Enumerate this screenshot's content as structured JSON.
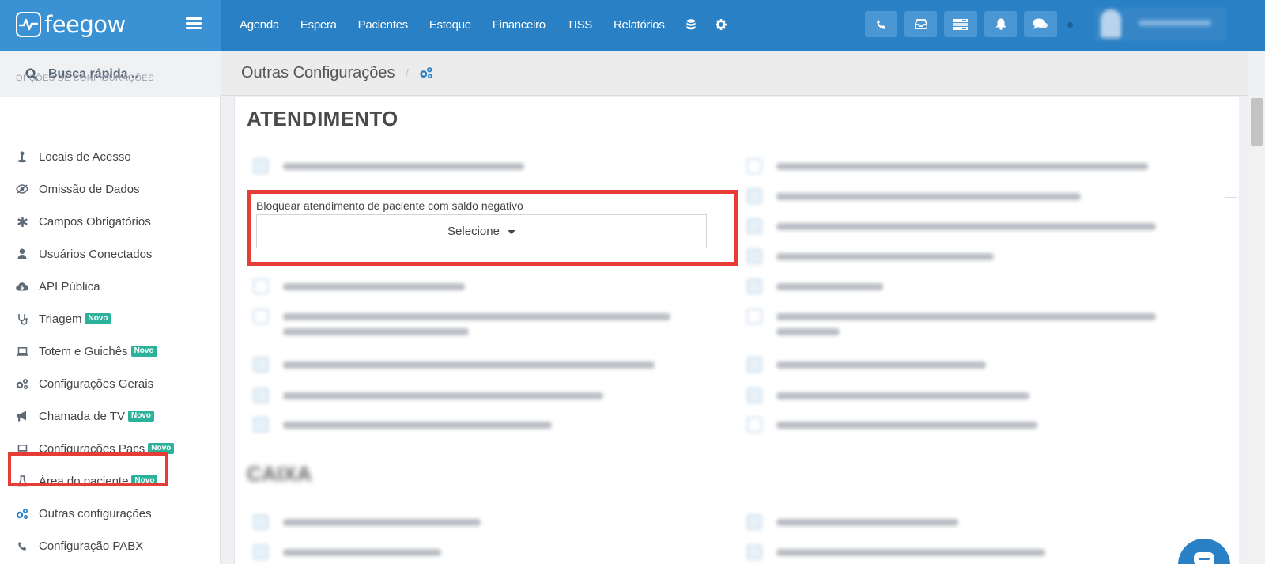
{
  "brand": {
    "name": "feegow"
  },
  "topnav": {
    "items": [
      {
        "label": "Agenda"
      },
      {
        "label": "Espera"
      },
      {
        "label": "Pacientes"
      },
      {
        "label": "Estoque"
      },
      {
        "label": "Financeiro"
      },
      {
        "label": "TISS"
      },
      {
        "label": "Relatórios"
      }
    ],
    "icons": [
      "database-icon",
      "gear-icon"
    ],
    "tool_buttons": [
      "phone-icon",
      "inbox-icon",
      "list-icon",
      "bell-icon",
      "chat-icon"
    ]
  },
  "sidebar": {
    "search_placeholder": "Busca rápida...",
    "section_label": "OPÇÕES DE CONFIGURAÇÕES",
    "items": [
      {
        "label": "Locais de Acesso",
        "icon": "location-icon"
      },
      {
        "label": "Omissão de Dados",
        "icon": "eye-slash-icon"
      },
      {
        "label": "Campos Obrigatórios",
        "icon": "asterisk-icon"
      },
      {
        "label": "Usuários Conectados",
        "icon": "user-icon"
      },
      {
        "label": "API Pública",
        "icon": "cloud-icon"
      },
      {
        "label": "Triagem",
        "icon": "stethoscope-icon",
        "badge": "Novo"
      },
      {
        "label": "Totem e Guichês",
        "icon": "laptop-icon",
        "badge": "Novo"
      },
      {
        "label": "Configurações Gerais",
        "icon": "cogs-icon"
      },
      {
        "label": "Chamada de TV",
        "icon": "bullhorn-icon",
        "badge": "Novo"
      },
      {
        "label": "Configurações Pacs",
        "icon": "laptop-icon",
        "badge": "Novo"
      },
      {
        "label": "Área do paciente",
        "icon": "flask-icon",
        "badge": "Novo"
      },
      {
        "label": "Outras configurações",
        "icon": "cogs-icon",
        "active": true
      },
      {
        "label": "Configuração PABX",
        "icon": "phone-icon"
      }
    ]
  },
  "page": {
    "title": "Outras Configurações",
    "breadcrumb_sep": "/"
  },
  "sections": [
    {
      "title": "ATENDIMENTO"
    },
    {
      "title": "CAIXA"
    }
  ],
  "highlight_field": {
    "label": "Bloquear atendimento de paciente com saldo negativo",
    "select_value": "Selecione"
  },
  "colors": {
    "topbar": "#2a80c4",
    "brand_bg": "#3a92d5",
    "badge": "#2cb19b",
    "highlight_border": "#e63c36"
  }
}
